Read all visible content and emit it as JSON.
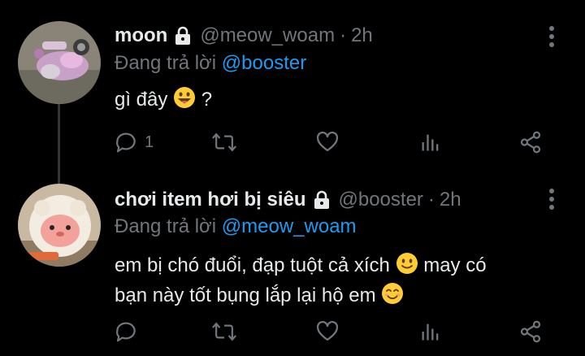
{
  "tweets": [
    {
      "name": "moon",
      "handle": "@meow_woam",
      "separator": "·",
      "time": "2h",
      "reply_prefix": "Đang trả lời",
      "reply_to": "@booster",
      "text_before": "gì đây",
      "emoji": "grinning-tongue-emoji",
      "text_after": " ?",
      "reply_count": "1"
    },
    {
      "name": "chơi item hơi bị siêu",
      "handle": "@booster",
      "separator": "·",
      "time": "2h",
      "reply_prefix": "Đang trả lời",
      "reply_to": "@meow_woam",
      "line1_text": "em bị chó đuổi, đạp tuột cả xích",
      "line1_emoji": "slightly-smiling-emoji",
      "line1_after": " may có",
      "line2_text": "bạn này tốt bụng lắp lại hộ em",
      "line2_emoji": "smiling-eyes-emoji"
    }
  ],
  "colors": {
    "background": "#000000",
    "text": "#e7e9ea",
    "muted": "#71767b",
    "accent": "#1d9bf0"
  }
}
